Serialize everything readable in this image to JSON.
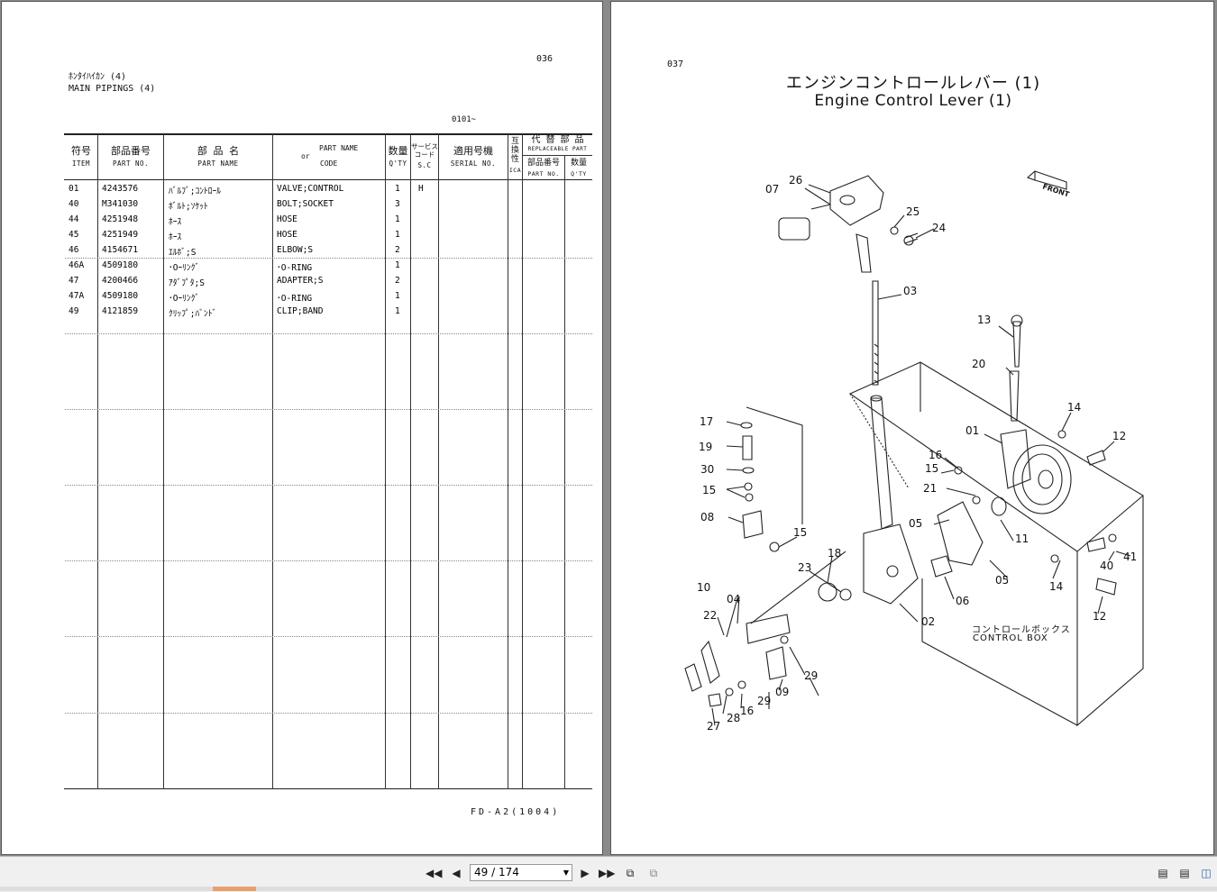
{
  "left_page": {
    "page_number": "036",
    "title_jp": "ﾎﾝﾀｲﾊｲｶﾝ (4)",
    "title_en": "MAIN PIPINGS (4)",
    "serial_range": "0101~",
    "headers": {
      "item_jp": "符号",
      "item_en": "ITEM",
      "partno_jp": "部品番号",
      "partno_en": "PART NO.",
      "partname_jp": "部 品 名",
      "partname_en": "PART NAME",
      "or": "or",
      "code_top": "PART NAME",
      "code_bottom": "CODE",
      "qty_jp": "数量",
      "qty_en": "Q'TY",
      "sc_jp": "サービスコード",
      "sc_en": "S.C",
      "serial_jp": "適用号機",
      "serial_en": "SERIAL NO.",
      "ica_jp": "互換性",
      "ica_en": "ICA",
      "repl_jp": "代 替 部 品",
      "repl_en": "REPLACEABLE PART",
      "repl_partno_jp": "部品番号",
      "repl_partno_en": "PART NO.",
      "repl_qty_jp": "数量",
      "repl_qty_en": "Q'TY"
    },
    "rows": [
      {
        "item": "01",
        "part_no": "4243576",
        "name_jp": "ﾊﾞﾙﾌﾞ;ｺﾝﾄﾛｰﾙ",
        "name": "VALVE;CONTROL",
        "qty": "1",
        "sc": "H"
      },
      {
        "item": "40",
        "part_no": "M341030",
        "name_jp": "ﾎﾞﾙﾄ;ｿｹｯﾄ",
        "name": "BOLT;SOCKET",
        "qty": "3",
        "sc": ""
      },
      {
        "item": "44",
        "part_no": "4251948",
        "name_jp": "ﾎｰｽ",
        "name": "HOSE",
        "qty": "1",
        "sc": ""
      },
      {
        "item": "45",
        "part_no": "4251949",
        "name_jp": "ﾎｰｽ",
        "name": "HOSE",
        "qty": "1",
        "sc": ""
      },
      {
        "item": "46",
        "part_no": "4154671",
        "name_jp": "ｴﾙﾎﾞ;S",
        "name": "ELBOW;S",
        "qty": "2",
        "sc": ""
      },
      {
        "item": "46A",
        "part_no": "4509180",
        "name_jp": "･Oｰﾘﾝｸﾞ",
        "name": "･O-RING",
        "qty": "1",
        "sc": ""
      },
      {
        "item": "47",
        "part_no": "4200466",
        "name_jp": "ｱﾀﾞﾌﾟﾀ;S",
        "name": "ADAPTER;S",
        "qty": "2",
        "sc": ""
      },
      {
        "item": "47A",
        "part_no": "4509180",
        "name_jp": "･Oｰﾘﾝｸﾞ",
        "name": "･O-RING",
        "qty": "1",
        "sc": ""
      },
      {
        "item": "49",
        "part_no": "4121859",
        "name_jp": "ｸﾘｯﾌﾟ;ﾊﾞﾝﾄﾞ",
        "name": "CLIP;BAND",
        "qty": "1",
        "sc": ""
      }
    ],
    "footer_code": "FD-A2(1004)"
  },
  "right_page": {
    "page_number": "037",
    "title_jp": "エンジンコントロールレバー (1)",
    "title_en": "Engine Control Lever (1)",
    "front_label": "FRONT",
    "box_label_jp": "コントロールボックス",
    "box_label_en": "CONTROL BOX",
    "callouts": [
      "07",
      "26",
      "25",
      "24",
      "03",
      "13",
      "20",
      "14",
      "12",
      "01",
      "17",
      "19",
      "30",
      "16",
      "15",
      "21",
      "15",
      "08",
      "05",
      "11",
      "15",
      "18",
      "41",
      "40",
      "23",
      "10",
      "04",
      "06",
      "05",
      "22",
      "14",
      "02",
      "12",
      "29",
      "09",
      "29",
      "16",
      "28",
      "27"
    ]
  },
  "toolbar": {
    "first_icon": "first-page-icon",
    "prev_icon": "prev-page-icon",
    "page_indicator": "49 / 174",
    "next_icon": "next-page-icon",
    "last_icon": "last-page-icon"
  }
}
